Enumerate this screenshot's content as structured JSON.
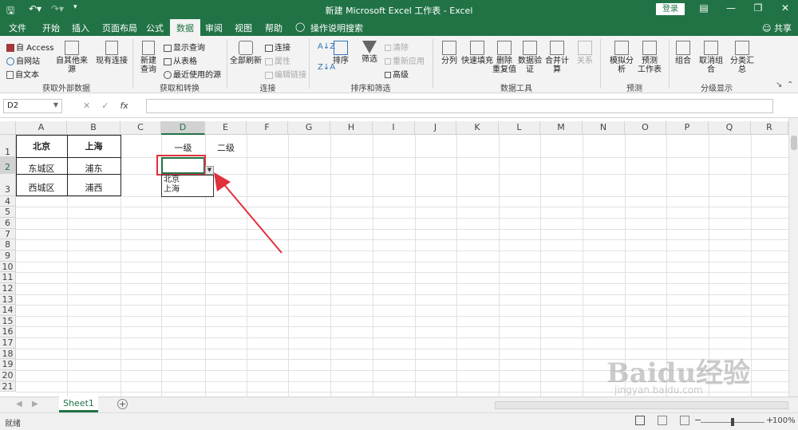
{
  "titlebar": {
    "title": "新建 Microsoft Excel 工作表 - Excel",
    "login_label": "登录"
  },
  "menu": {
    "tabs": [
      "文件",
      "开始",
      "插入",
      "页面布局",
      "公式",
      "数据",
      "审阅",
      "视图",
      "帮助"
    ],
    "active_tab": "数据",
    "tell_me": "操作说明搜索",
    "share": "共享"
  },
  "ribbon": {
    "get_external": {
      "access": "自 Access",
      "web": "自网站",
      "text": "自文本",
      "other_sources": "自其他来源",
      "existing_connections": "现有连接",
      "label": "获取外部数据"
    },
    "get_transform": {
      "new_query": "新建\n查询",
      "show_queries": "显示查询",
      "from_table": "从表格",
      "recent_sources": "最近使用的源",
      "label": "获取和转换"
    },
    "connections": {
      "refresh_all": "全部刷新",
      "connections": "连接",
      "properties": "属性",
      "edit_links": "编辑链接",
      "label": "连接"
    },
    "sort_filter": {
      "sort": "排序",
      "filter": "筛选",
      "clear": "清除",
      "reapply": "重新应用",
      "advanced": "高级",
      "label": "排序和筛选"
    },
    "data_tools": {
      "text_to_columns": "分列",
      "flash_fill": "快速填充",
      "remove_duplicates": "删除\n重复值",
      "data_validation": "数据验\n证",
      "consolidate": "合并计算",
      "relationships": "关系",
      "label": "数据工具"
    },
    "forecast": {
      "what_if": "模拟分析",
      "forecast_sheet": "预测\n工作表",
      "label": "预测"
    },
    "outline": {
      "group": "组合",
      "ungroup": "取消组合",
      "subtotal": "分类汇总",
      "label": "分级显示"
    }
  },
  "formula_bar": {
    "name_box": "D2",
    "fx": "fx",
    "value": ""
  },
  "grid": {
    "columns": [
      "A",
      "B",
      "C",
      "D",
      "E",
      "F",
      "G",
      "H",
      "I",
      "J",
      "K",
      "L",
      "M",
      "N",
      "O",
      "P",
      "Q",
      "R"
    ],
    "rows": [
      "1",
      "2",
      "3",
      "4",
      "5",
      "6",
      "7",
      "8",
      "9",
      "10",
      "11",
      "12",
      "13",
      "14",
      "15",
      "16",
      "17",
      "18",
      "19",
      "20",
      "21"
    ],
    "cells": {
      "A1": "北京",
      "B1": "上海",
      "A2": "东城区",
      "B2": "浦东",
      "A3": "西城区",
      "B3": "浦西",
      "D1": "一级",
      "E1": "二级"
    },
    "selected_cell": "D2",
    "dropdown_options": [
      "北京",
      "上海"
    ]
  },
  "sheets": {
    "tabs": [
      "Sheet1"
    ]
  },
  "status": {
    "ready": "就绪",
    "zoom": "100%"
  },
  "watermark": {
    "text": "Baidu经验",
    "sub": "jingyan.baidu.com"
  },
  "colors": {
    "accent": "#217346",
    "highlight": "#e0313c"
  }
}
